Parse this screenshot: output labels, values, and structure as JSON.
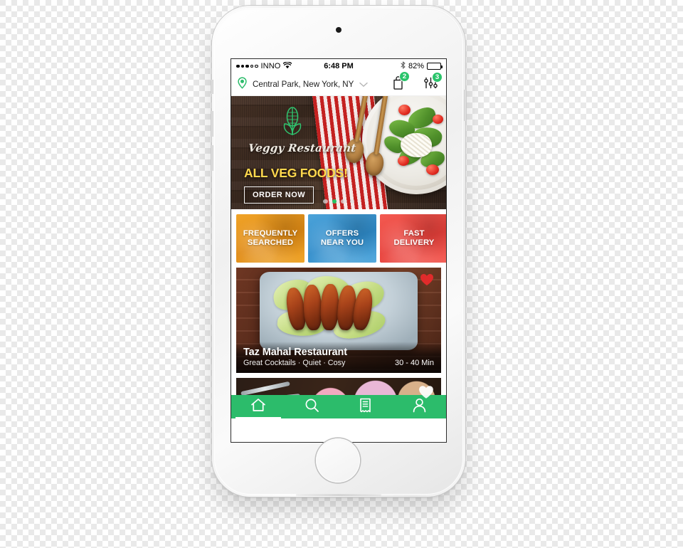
{
  "device": {
    "name": "iphone-white",
    "camera_icon": "front-camera-icon",
    "sensor_icon": "proximity-sensor-icon",
    "speaker_icon": "earpiece-speaker-icon",
    "home_button": "home-button"
  },
  "status_bar": {
    "signal_icon": "signal-dots-icon",
    "signal_bars_filled": 3,
    "signal_bars_total": 5,
    "carrier": "INNO",
    "wifi_icon": "wifi-icon",
    "time": "6:48 PM",
    "bluetooth_icon": "bluetooth-icon",
    "battery_percent": "82%",
    "battery_level": 82,
    "battery_icon": "battery-icon"
  },
  "location_bar": {
    "pin_icon": "location-pin-icon",
    "location": "Central Park, New York, NY",
    "chevron_icon": "chevron-down-icon",
    "bag_icon": "shopping-bag-icon",
    "bag_badge": "2",
    "filter_icon": "filter-sliders-icon",
    "filter_badge": "3",
    "badge_color": "#29c46a"
  },
  "hero": {
    "logo_icon": "corn-plant-logo-icon",
    "brand": "Veggy Restaurant",
    "headline": "ALL VEG FOODS!",
    "cta_label": "ORDER NOW",
    "headline_color": "#ffd84d",
    "dots_total": 4,
    "active_dot_index": 1,
    "active_dot_color": "#27c261"
  },
  "categories": [
    {
      "line1": "FREQUENTLY",
      "line2": "SEARCHED",
      "color": "#e8930f",
      "name": "frequently-searched"
    },
    {
      "line1": "OFFERS",
      "line2": "NEAR YOU",
      "color": "#2f8ccb",
      "name": "offers-near-you"
    },
    {
      "line1": "FAST",
      "line2": "DELIVERY",
      "color": "#e8403a",
      "name": "fast-delivery"
    }
  ],
  "restaurants": [
    {
      "name": "Taz Mahal Restaurant",
      "tags": "Great Cocktails · Quiet · Cosy",
      "delivery_time": "30 - 40 Min",
      "favorite_icon": "heart-filled-icon",
      "favorite": true,
      "photo": "grilled-chicken-wings-on-lettuce"
    },
    {
      "name": "",
      "tags": "",
      "delivery_time": "",
      "favorite_icon": "heart-outline-icon",
      "favorite": false,
      "photo": "dessert-smoothie-bowls"
    }
  ],
  "bottom_nav": {
    "background": "#2cbc6b",
    "items": [
      {
        "icon": "home-icon",
        "name": "nav-home",
        "active": true
      },
      {
        "icon": "search-icon",
        "name": "nav-search",
        "active": false
      },
      {
        "icon": "receipt-icon",
        "name": "nav-orders",
        "active": false
      },
      {
        "icon": "person-icon",
        "name": "nav-profile",
        "active": false
      }
    ]
  }
}
